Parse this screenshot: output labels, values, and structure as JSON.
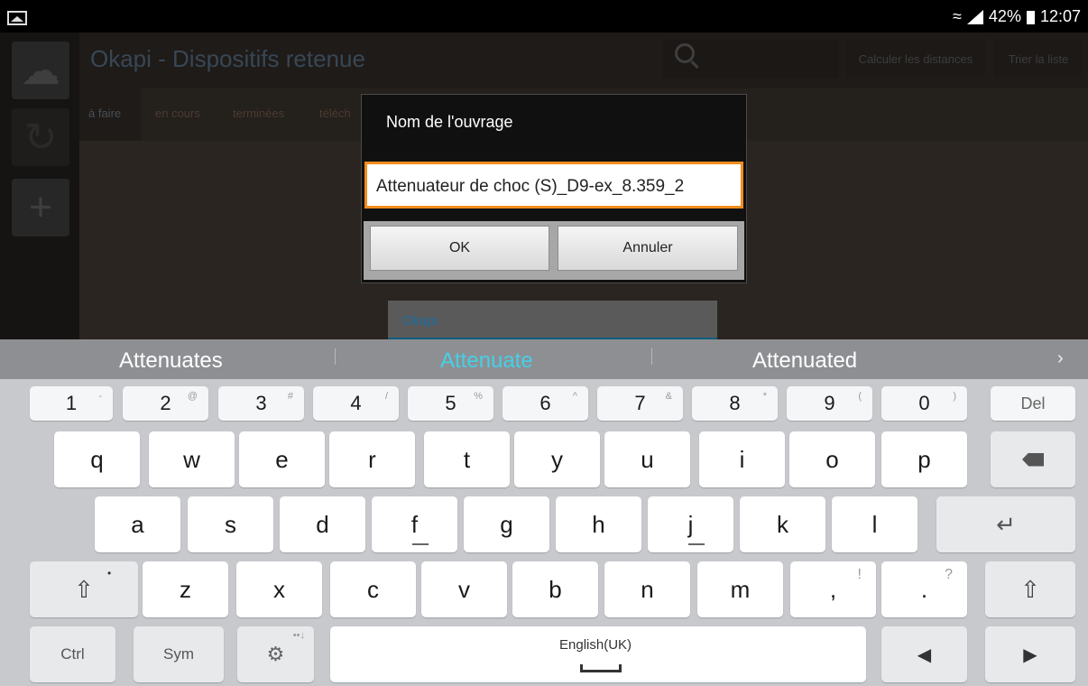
{
  "statusbar": {
    "battery": "42%",
    "time": "12:07"
  },
  "app": {
    "title": "Okapi - Dispositifs retenue",
    "buttons": {
      "calc": "Calculer les distances",
      "sort": "Trier la liste"
    },
    "tabs": [
      "à faire",
      "en cours",
      "terminées",
      "téléch"
    ],
    "card_label": "Okapi"
  },
  "dialog": {
    "title": "Nom de l'ouvrage",
    "input_value": "Attenuateur de choc (S)_D9-ex_8.359_2",
    "ok": "OK",
    "cancel": "Annuler"
  },
  "suggestions": [
    "Attenuates",
    "Attenuate",
    "Attenuated"
  ],
  "keyboard": {
    "numbers": [
      {
        "main": "1",
        "sub": "-"
      },
      {
        "main": "2",
        "sub": "@"
      },
      {
        "main": "3",
        "sub": "#"
      },
      {
        "main": "4",
        "sub": "/"
      },
      {
        "main": "5",
        "sub": "%"
      },
      {
        "main": "6",
        "sub": "^"
      },
      {
        "main": "7",
        "sub": "&"
      },
      {
        "main": "8",
        "sub": "*"
      },
      {
        "main": "9",
        "sub": "("
      },
      {
        "main": "0",
        "sub": ")"
      }
    ],
    "del": "Del",
    "row1": [
      "q",
      "w",
      "e",
      "r",
      "t",
      "y",
      "u",
      "i",
      "o",
      "p"
    ],
    "row2": [
      "a",
      "s",
      "d",
      "f",
      "g",
      "h",
      "j",
      "k",
      "l"
    ],
    "row3": [
      "z",
      "x",
      "c",
      "v",
      "b",
      "n",
      "m"
    ],
    "comma": ",",
    "comma_sub": "!",
    "period": ".",
    "period_sub": "?",
    "ctrl": "Ctrl",
    "sym": "Sym",
    "language": "English(UK)"
  }
}
